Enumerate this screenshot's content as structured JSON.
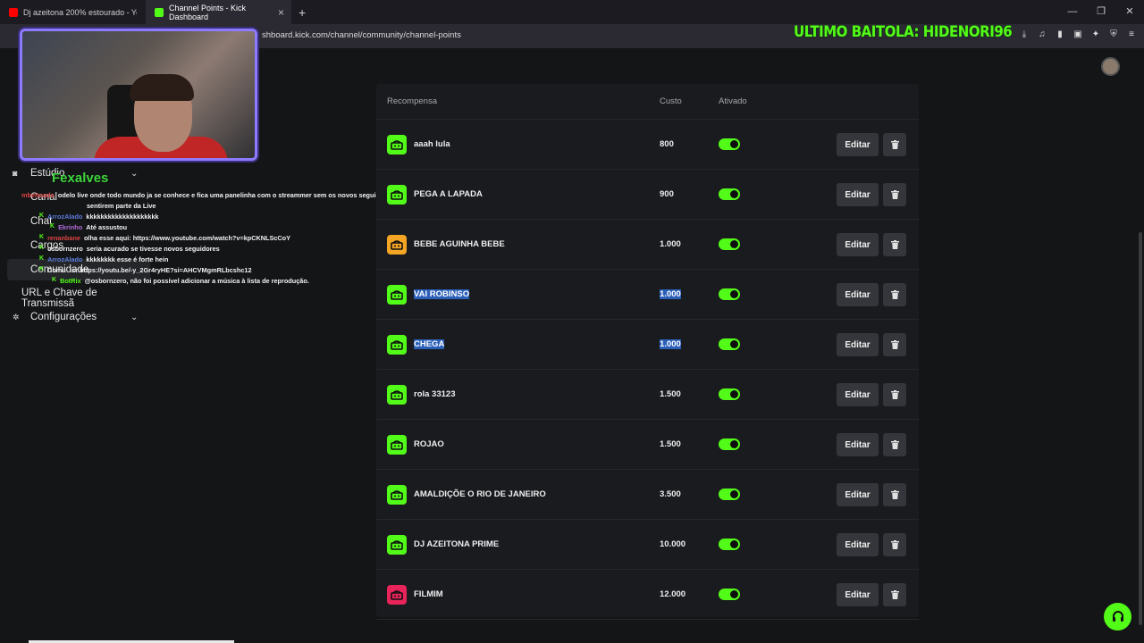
{
  "browser": {
    "tabs": [
      {
        "label": "Dj azeitona 200% estourado - YouTube",
        "icon": "youtube-icon",
        "color": "#ff0000"
      },
      {
        "label": "Channel Points - Kick Dashboard",
        "icon": "kick-icon",
        "color": "#53fc18"
      }
    ],
    "url": "shboard.kick.com/channel/community/channel-points",
    "window_controls": [
      "—",
      "❐",
      "✕"
    ]
  },
  "overlay": {
    "title": "ULTIMO BAITOLA: HIDENORI96",
    "cam_name": "Fexalves",
    "accent": "#53fc18"
  },
  "sidebar": {
    "items": [
      {
        "label": "Estúdio",
        "icon": "camera-icon"
      },
      {
        "label": "Configurações",
        "icon": "gear-icon"
      }
    ],
    "subitems": [
      "Canal",
      "Chat",
      "Cargos",
      "Comunidade",
      "URL e Chave de Transmissã"
    ]
  },
  "chat": [
    {
      "user": "mbeitoado",
      "msg": "odelo live onde todo mundo ja se conhece e fica uma panelinha com o streammer sem os novos seguidores se",
      "color": "#d44"
    },
    {
      "user": "",
      "msg": "sentirem parte da Live",
      "color": "#fff"
    },
    {
      "user": "ArrozAlado",
      "msg": "kkkkkkkkkkkkkkkkkkkk",
      "color": "#5b7bd8"
    },
    {
      "user": "Ekrinho",
      "msg": "Até assustou",
      "color": "#b06ad8"
    },
    {
      "user": "renanbane",
      "msg": "olha esse aqui: https://www.youtube.com/watch?v=kpCKNLScCoY",
      "color": "#d44"
    },
    {
      "user": "osbornzero",
      "msg": "seria acurado se tivesse novos seguidores",
      "color": "#ddd"
    },
    {
      "user": "ArrozAlado",
      "msg": "kkkkkkkk esse é forte hein",
      "color": "#5b7bd8"
    },
    {
      "user": "Comu",
      "msg": "!sr https://youtu.be/-y_2Gr4ryHE?si=AHCVMgmRLbcshc12",
      "color": "#ddd"
    },
    {
      "user": "BotRix",
      "msg": "@osbornzero, não foi possível adicionar a música à lista de reprodução.",
      "color": "#ddd"
    }
  ],
  "table": {
    "headers": {
      "reward": "Recompensa",
      "cost": "Custo",
      "active": "Ativado"
    },
    "edit_label": "Editar",
    "rows": [
      {
        "name": "aaah lula",
        "cost": "800",
        "color": "#53fc18",
        "active": true,
        "highlight": false
      },
      {
        "name": "PEGA A LAPADA",
        "cost": "900",
        "color": "#53fc18",
        "active": true,
        "highlight": false
      },
      {
        "name": "BEBE AGUINHA BEBE",
        "cost": "1.000",
        "color": "#f5a524",
        "active": true,
        "highlight": false
      },
      {
        "name": "VAI ROBINSO",
        "cost": "1.000",
        "color": "#53fc18",
        "active": true,
        "highlight": true
      },
      {
        "name": "CHEGA",
        "cost": "1.000",
        "color": "#53fc18",
        "active": true,
        "highlight": true
      },
      {
        "name": "rola 33123",
        "cost": "1.500",
        "color": "#53fc18",
        "active": true,
        "highlight": false
      },
      {
        "name": "ROJAO",
        "cost": "1.500",
        "color": "#53fc18",
        "active": true,
        "highlight": false
      },
      {
        "name": "AMALDIÇÕE O RIO DE JANEIRO",
        "cost": "3.500",
        "color": "#53fc18",
        "active": true,
        "highlight": false
      },
      {
        "name": "DJ AZEITONA PRIME",
        "cost": "10.000",
        "color": "#53fc18",
        "active": true,
        "highlight": false
      },
      {
        "name": "FILMIM",
        "cost": "12.000",
        "color": "#e8245a",
        "active": true,
        "highlight": false
      }
    ]
  }
}
